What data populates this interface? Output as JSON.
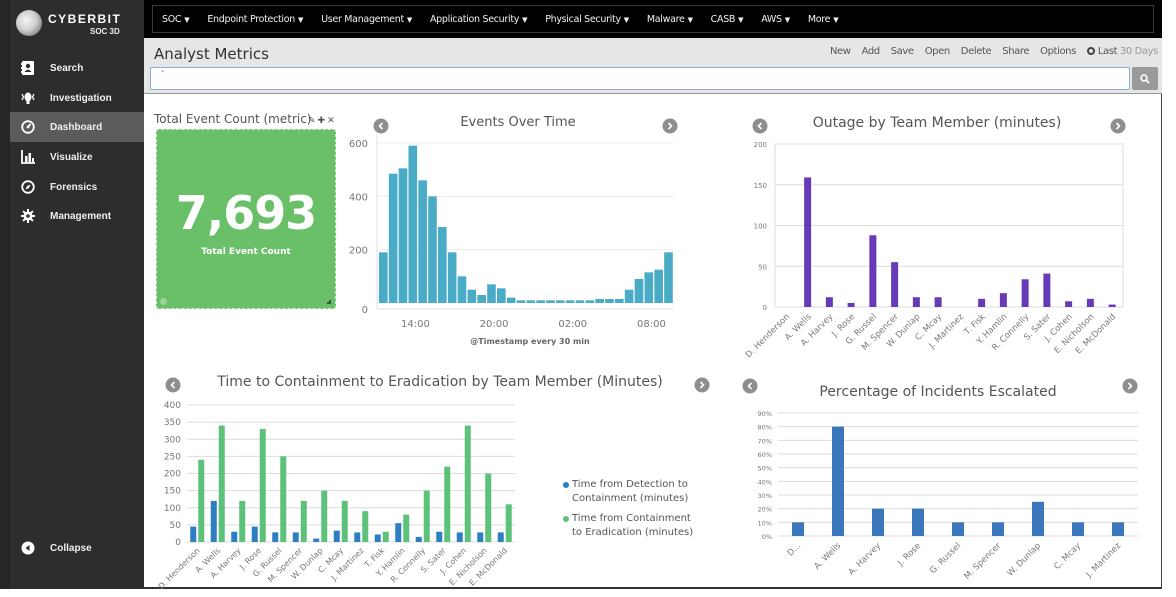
{
  "app": {
    "brand": "CYBERBIT",
    "product": "SOC 3D"
  },
  "sidebar": {
    "items": [
      {
        "label": "Search",
        "icon": "contact-book-icon"
      },
      {
        "label": "Investigation",
        "icon": "investigation-icon"
      },
      {
        "label": "Dashboard",
        "icon": "dashboard-gauge-icon",
        "active": true
      },
      {
        "label": "Visualize",
        "icon": "bar-chart-icon"
      },
      {
        "label": "Forensics",
        "icon": "compass-icon"
      },
      {
        "label": "Management",
        "icon": "gear-icon"
      }
    ],
    "collapse_label": "Collapse"
  },
  "topnav": {
    "items": [
      {
        "label": "SOC"
      },
      {
        "label": "Endpoint Protection"
      },
      {
        "label": "User Management"
      },
      {
        "label": "Application Security"
      },
      {
        "label": "Physical Security"
      },
      {
        "label": "Malware"
      },
      {
        "label": "CASB"
      },
      {
        "label": "AWS"
      },
      {
        "label": "More"
      }
    ]
  },
  "titlebar": {
    "title": "Analyst Metrics",
    "actions": [
      "New",
      "Add",
      "Save",
      "Open",
      "Delete",
      "Share",
      "Options"
    ],
    "time_prefix": "Last",
    "time_range": "30 Days",
    "search_value": "`"
  },
  "metric_panel": {
    "title": "Total Event Count (metric)",
    "value": "7,693",
    "label": "Total Event Count"
  },
  "colors": {
    "metric_bg": "#6abf69",
    "events_bar": "#4aabc6",
    "outage_bar": "#673ab7",
    "detection_series": "#2e7ec1",
    "containment_series": "#5cc27a",
    "escalated_bar": "#3a76ba"
  },
  "chart_data": [
    {
      "id": "events",
      "type": "bar",
      "title": "Events Over Time",
      "xlabel": "@Timestamp every 30 min",
      "ylabel": "",
      "ylim": [
        0,
        600
      ],
      "yticks": [
        0,
        200,
        400,
        600
      ],
      "xtick_labels": [
        {
          "label": "14:00",
          "index": 3
        },
        {
          "label": "20:00",
          "index": 11
        },
        {
          "label": "02:00",
          "index": 19
        },
        {
          "label": "08:00",
          "index": 27
        }
      ],
      "values": [
        190,
        485,
        505,
        590,
        460,
        400,
        285,
        190,
        100,
        50,
        30,
        70,
        55,
        20,
        10,
        10,
        10,
        10,
        10,
        10,
        10,
        10,
        15,
        15,
        15,
        50,
        90,
        115,
        125,
        190
      ],
      "grid": true
    },
    {
      "id": "outage",
      "type": "bar",
      "title": "Outage by Team Member (minutes)",
      "ylim": [
        0,
        200
      ],
      "yticks": [
        0,
        50,
        100,
        150,
        200
      ],
      "categories": [
        "D. Henderson",
        "A. Wells",
        "A. Harvey",
        "J. Rose",
        "G. Russel",
        "M. Spencer",
        "W. Dunlap",
        "C. Mcay",
        "J. Martinez",
        "T. Fisk",
        "Y. Hamlin",
        "R. Connelly",
        "S. Sater",
        "J. Cohen",
        "E. Nicholson",
        "E. McDonald"
      ],
      "values": [
        0,
        159,
        12,
        5,
        88,
        55,
        12,
        12,
        0,
        10,
        17,
        34,
        41,
        7,
        10,
        3
      ],
      "grid": true
    },
    {
      "id": "containment",
      "type": "bar",
      "title": "Time to Containment to Eradication by Team Member (Minutes)",
      "ylim": [
        0,
        400
      ],
      "yticks": [
        0,
        50,
        100,
        150,
        200,
        250,
        300,
        350,
        400
      ],
      "categories": [
        "D. Henderson",
        "A. Wells",
        "A. Harvey",
        "J. Rose",
        "G. Russel",
        "M. Spencer",
        "W. Dunlap",
        "C. Mcay",
        "J. Martinez",
        "T. Fisk",
        "Y. Hamlin",
        "R. Connelly",
        "S. Sater",
        "J. Cohen",
        "E. Nicholson",
        "E. McDonald"
      ],
      "series": [
        {
          "name": "Time from Detection to Containment (minutes)",
          "values": [
            45,
            120,
            30,
            45,
            28,
            28,
            10,
            33,
            28,
            22,
            55,
            15,
            30,
            28,
            28,
            28
          ]
        },
        {
          "name": "Time from Containment to Eradication (minutes)",
          "values": [
            240,
            340,
            120,
            330,
            250,
            120,
            150,
            120,
            90,
            30,
            80,
            150,
            220,
            340,
            200,
            110
          ]
        }
      ],
      "legend": "right",
      "grid": true
    },
    {
      "id": "escalated",
      "type": "bar",
      "title": "Percentage of Incidents Escalated",
      "ylim": [
        0,
        90
      ],
      "yticks": [
        "0%",
        "10%",
        "20%",
        "30%",
        "40%",
        "50%",
        "60%",
        "70%",
        "80%",
        "90%"
      ],
      "categories": [
        "D...",
        "A. Wells",
        "A. Harvey",
        "J. Rose",
        "G. Russel",
        "M. Spencer",
        "W. Dunlap",
        "C. Mcay",
        "J. Martinez"
      ],
      "values": [
        10,
        80,
        20,
        20,
        10,
        10,
        25,
        10,
        10
      ],
      "grid": true
    }
  ]
}
